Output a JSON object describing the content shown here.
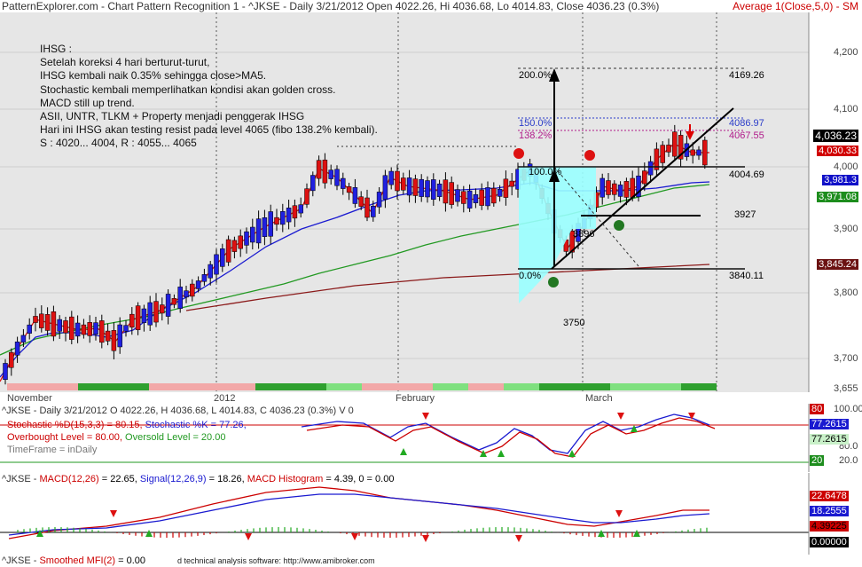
{
  "title": {
    "left": "PatternExplorer.com - Chart Pattern Recognition 1 - ^JKSE - Daily 3/21/2012 Open 4022.26, Hi 4036.68, Lo 4014.83, Close 4036.23 (0.3%)",
    "right": "Average 1(Close,5,0) - SM"
  },
  "notes": [
    "IHSG :",
    "Setelah koreksi 4 hari berturut-turut,",
    "IHSG kembali naik 0.35% sehingga close>MA5.",
    "Stochastic kembali memperlihatkan kondisi akan golden cross.",
    "MACD still up trend.",
    "ASII, UNTR, TLKM + Property menjadi penggerak IHSG",
    "Hari ini IHSG akan testing resist pada level 4065 (fibo 138.2% kembali).",
    "S : 4020... 4004, R : 4055... 4065"
  ],
  "price_axis": [
    "4,200",
    "4,100",
    "4,000",
    "3,900",
    "3,800",
    "3,700",
    "3,655"
  ],
  "tags": {
    "close": "4,036.23",
    "ma5": "4,030.33",
    "ma20": "3,981.3",
    "ma50": "3,971.08",
    "ma200": "3,845.24"
  },
  "levels": {
    "l4169": "4169.26",
    "l4087": "4086.97",
    "l4068": "4067.55",
    "l4005": "4004.69",
    "l3927": "3927",
    "l3840": "3840.11",
    "l3896": "3896",
    "l3750": "3750"
  },
  "fib": {
    "f200": "200.0%",
    "f150": "150.0%",
    "f138": "138.2%",
    "f100": "100.0%",
    "f0": "0.0%"
  },
  "markers": {
    "m1": "1",
    "m2": "2"
  },
  "months": [
    "November",
    "2012",
    "February",
    "March"
  ],
  "stoch": {
    "l1_pre": "^JKSE - Daily 3/21/2012 O 4022.26, H 4036.68, L 4014.83, C 4036.23 (0.3%) V 0",
    "l2a": "Stochastic %D(15,3,3) = 80.15,",
    "l2b": "Stochastic %K = 77.26,",
    "l3a": "Overbought Level = 80.00,",
    "l3b": "Oversold Level = 20.00",
    "l4": "TimeFrame = inDaily",
    "axis": [
      "100.00",
      "80.0",
      "20.0"
    ],
    "tags": [
      "80",
      "77.2615",
      "77.2615",
      "20"
    ]
  },
  "macd": {
    "pre": "^JKSE -",
    "a": "MACD(12,26)",
    "b": "= 22.65,",
    "c": "Signal(12,26,9)",
    "d": "= 18.26,",
    "e": "MACD Histogram",
    "f": "= 4.39, 0 = 0.00",
    "tags": [
      "22.6478",
      "18.2555",
      "4.39225",
      "0.00000"
    ]
  },
  "mfi": {
    "pre": "^JKSE -",
    "a": "Smoothed MFI(2)",
    "b": "= 0.00",
    "credit": "d technical analysis software: http://www.amibroker.com"
  },
  "colors": {
    "up": "#2020e0",
    "down": "#dd1111",
    "ma5": "#dd1111",
    "ma20": "#1a1ad0",
    "ma50": "#229922",
    "ma200": "#8b1a1a"
  }
}
